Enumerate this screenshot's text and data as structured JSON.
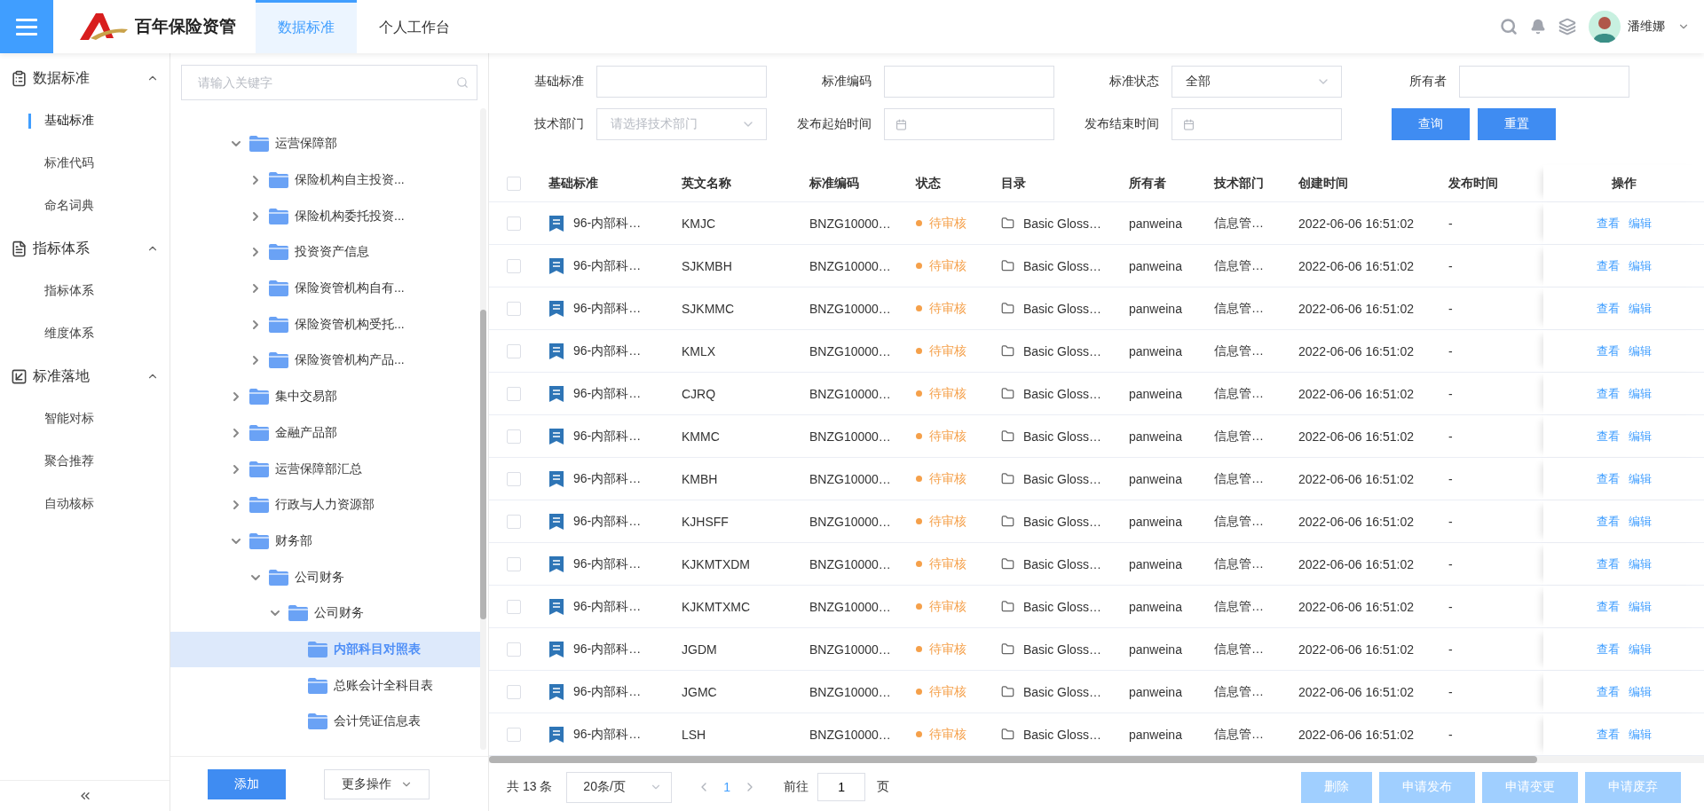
{
  "header": {
    "logo_text": "百年保险资管",
    "tabs": [
      {
        "label": "数据标准",
        "selected": true
      },
      {
        "label": "个人工作台",
        "selected": false
      }
    ],
    "user": {
      "name": "潘维娜"
    }
  },
  "sidebar": {
    "groups": [
      {
        "label": "数据标准",
        "expanded": true,
        "items": [
          {
            "label": "基础标准",
            "selected": true
          },
          {
            "label": "标准代码",
            "selected": false
          },
          {
            "label": "命名词典",
            "selected": false
          }
        ]
      },
      {
        "label": "指标体系",
        "expanded": true,
        "items": [
          {
            "label": "指标体系",
            "selected": false
          },
          {
            "label": "维度体系",
            "selected": false
          }
        ]
      },
      {
        "label": "标准落地",
        "expanded": true,
        "items": [
          {
            "label": "智能对标",
            "selected": false
          },
          {
            "label": "聚合推荐",
            "selected": false
          },
          {
            "label": "自动核标",
            "selected": false
          }
        ]
      }
    ]
  },
  "tree": {
    "search_placeholder": "请输入关键字",
    "nodes": [
      {
        "label": "运营保障部",
        "expanded": true,
        "selected": false,
        "children": [
          {
            "label": "保险机构自主投资...",
            "expanded": false,
            "selected": false
          },
          {
            "label": "保险机构委托投资...",
            "expanded": false,
            "selected": false
          },
          {
            "label": "投资资产信息",
            "expanded": false,
            "selected": false
          },
          {
            "label": "保险资管机构自有...",
            "expanded": false,
            "selected": false
          },
          {
            "label": "保险资管机构受托...",
            "expanded": false,
            "selected": false
          },
          {
            "label": "保险资管机构产品...",
            "expanded": false,
            "selected": false
          }
        ]
      },
      {
        "label": "集中交易部",
        "expanded": false,
        "selected": false
      },
      {
        "label": "金融产品部",
        "expanded": false,
        "selected": false
      },
      {
        "label": "运营保障部汇总",
        "expanded": false,
        "selected": false
      },
      {
        "label": "行政与人力资源部",
        "expanded": false,
        "selected": false
      },
      {
        "label": "财务部",
        "expanded": true,
        "selected": false,
        "children": [
          {
            "label": "公司财务",
            "expanded": true,
            "selected": false,
            "children": [
              {
                "label": "公司财务",
                "expanded": true,
                "selected": false,
                "children": [
                  {
                    "label": "内部科目对照表",
                    "selected": true
                  },
                  {
                    "label": "总账会计全科目表",
                    "selected": false
                  },
                  {
                    "label": "会计凭证信息表",
                    "selected": false
                  }
                ]
              }
            ]
          }
        ]
      }
    ],
    "add_button": "添加",
    "more_button": "更多操作"
  },
  "filters": {
    "fields": [
      {
        "label": "基础标准",
        "kind": "text"
      },
      {
        "label": "标准编码",
        "kind": "text"
      },
      {
        "label": "标准状态",
        "kind": "select",
        "value": "全部"
      },
      {
        "label": "所有者",
        "kind": "text"
      },
      {
        "label": "技术部门",
        "kind": "select",
        "placeholder": "请选择技术部门"
      },
      {
        "label": "发布起始时间",
        "kind": "date"
      },
      {
        "label": "发布结束时间",
        "kind": "date"
      }
    ],
    "buttons": [
      "查询",
      "重置"
    ]
  },
  "table": {
    "all_checked": false,
    "columns": [
      "基础标准",
      "英文名称",
      "标准编码",
      "状态",
      "目录",
      "所有者",
      "技术部门",
      "创建时间",
      "发布时间"
    ],
    "actions_label": "操作",
    "rows": [
      {
        "checked": false,
        "name": "96-内部科…",
        "english_name": "KMJC",
        "code": "BNZG10000…",
        "status": "待审核",
        "catalog": "Basic Gloss…",
        "owner": "panweina",
        "department": "信息管…",
        "created": "2022-06-06 16:51:02",
        "published": "-",
        "actions": [
          "查看",
          "编辑"
        ]
      },
      {
        "checked": false,
        "name": "96-内部科…",
        "english_name": "SJKMBH",
        "code": "BNZG10000…",
        "status": "待审核",
        "catalog": "Basic Gloss…",
        "owner": "panweina",
        "department": "信息管…",
        "created": "2022-06-06 16:51:02",
        "published": "-",
        "actions": [
          "查看",
          "编辑"
        ]
      },
      {
        "checked": false,
        "name": "96-内部科…",
        "english_name": "SJKMMC",
        "code": "BNZG10000…",
        "status": "待审核",
        "catalog": "Basic Gloss…",
        "owner": "panweina",
        "department": "信息管…",
        "created": "2022-06-06 16:51:02",
        "published": "-",
        "actions": [
          "查看",
          "编辑"
        ]
      },
      {
        "checked": false,
        "name": "96-内部科…",
        "english_name": "KMLX",
        "code": "BNZG10000…",
        "status": "待审核",
        "catalog": "Basic Gloss…",
        "owner": "panweina",
        "department": "信息管…",
        "created": "2022-06-06 16:51:02",
        "published": "-",
        "actions": [
          "查看",
          "编辑"
        ]
      },
      {
        "checked": false,
        "name": "96-内部科…",
        "english_name": "CJRQ",
        "code": "BNZG10000…",
        "status": "待审核",
        "catalog": "Basic Gloss…",
        "owner": "panweina",
        "department": "信息管…",
        "created": "2022-06-06 16:51:02",
        "published": "-",
        "actions": [
          "查看",
          "编辑"
        ]
      },
      {
        "checked": false,
        "name": "96-内部科…",
        "english_name": "KMMC",
        "code": "BNZG10000…",
        "status": "待审核",
        "catalog": "Basic Gloss…",
        "owner": "panweina",
        "department": "信息管…",
        "created": "2022-06-06 16:51:02",
        "published": "-",
        "actions": [
          "查看",
          "编辑"
        ]
      },
      {
        "checked": false,
        "name": "96-内部科…",
        "english_name": "KMBH",
        "code": "BNZG10000…",
        "status": "待审核",
        "catalog": "Basic Gloss…",
        "owner": "panweina",
        "department": "信息管…",
        "created": "2022-06-06 16:51:02",
        "published": "-",
        "actions": [
          "查看",
          "编辑"
        ]
      },
      {
        "checked": false,
        "name": "96-内部科…",
        "english_name": "KJHSFF",
        "code": "BNZG10000…",
        "status": "待审核",
        "catalog": "Basic Gloss…",
        "owner": "panweina",
        "department": "信息管…",
        "created": "2022-06-06 16:51:02",
        "published": "-",
        "actions": [
          "查看",
          "编辑"
        ]
      },
      {
        "checked": false,
        "name": "96-内部科…",
        "english_name": "KJKMTXDM",
        "code": "BNZG10000…",
        "status": "待审核",
        "catalog": "Basic Gloss…",
        "owner": "panweina",
        "department": "信息管…",
        "created": "2022-06-06 16:51:02",
        "published": "-",
        "actions": [
          "查看",
          "编辑"
        ]
      },
      {
        "checked": false,
        "name": "96-内部科…",
        "english_name": "KJKMTXMC",
        "code": "BNZG10000…",
        "status": "待审核",
        "catalog": "Basic Gloss…",
        "owner": "panweina",
        "department": "信息管…",
        "created": "2022-06-06 16:51:02",
        "published": "-",
        "actions": [
          "查看",
          "编辑"
        ]
      },
      {
        "checked": false,
        "name": "96-内部科…",
        "english_name": "JGDM",
        "code": "BNZG10000…",
        "status": "待审核",
        "catalog": "Basic Gloss…",
        "owner": "panweina",
        "department": "信息管…",
        "created": "2022-06-06 16:51:02",
        "published": "-",
        "actions": [
          "查看",
          "编辑"
        ]
      },
      {
        "checked": false,
        "name": "96-内部科…",
        "english_name": "JGMC",
        "code": "BNZG10000…",
        "status": "待审核",
        "catalog": "Basic Gloss…",
        "owner": "panweina",
        "department": "信息管…",
        "created": "2022-06-06 16:51:02",
        "published": "-",
        "actions": [
          "查看",
          "编辑"
        ]
      },
      {
        "checked": false,
        "name": "96-内部科…",
        "english_name": "LSH",
        "code": "BNZG10000…",
        "status": "待审核",
        "catalog": "Basic Gloss…",
        "owner": "panweina",
        "department": "信息管…",
        "created": "2022-06-06 16:51:02",
        "published": "-",
        "actions": [
          "查看",
          "编辑"
        ]
      }
    ]
  },
  "pagination": {
    "total": "共 13 条",
    "page_size": "20条/页",
    "pages": [
      {
        "label": "1",
        "selected": true
      }
    ],
    "goto_label": "前往",
    "goto_value": "1",
    "page_suffix": "页"
  },
  "bulk_actions": [
    {
      "label": "删除",
      "disabled": true
    },
    {
      "label": "申请发布",
      "disabled": true
    },
    {
      "label": "申请变更",
      "disabled": true
    },
    {
      "label": "申请废弃",
      "disabled": true
    }
  ]
}
